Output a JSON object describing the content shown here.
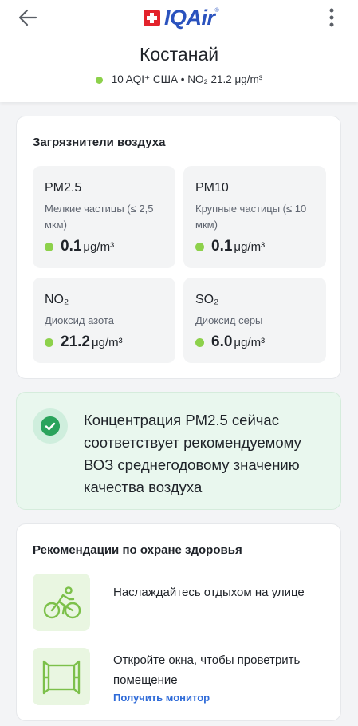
{
  "app": {
    "brand": "IQAir",
    "brand_tm": "®"
  },
  "header": {
    "city": "Костанай",
    "aqi_line": "10 AQI⁺ США • NO₂ 21.2 μg/m³"
  },
  "colors": {
    "good": "#8dd14b",
    "brand_blue": "#2a52be",
    "brand_red": "#e3232c",
    "link": "#2f6bd8",
    "who_green": "#2aa35c"
  },
  "icons": {
    "back": "arrow-left-icon",
    "menu": "more-vertical-icon",
    "check": "check-circle-icon",
    "bike": "bicycle-icon",
    "window": "open-window-icon"
  },
  "pollutants": {
    "title": "Загрязнители воздуха",
    "items": [
      {
        "name": "PM2.5",
        "desc": "Мелкие частицы (≤ 2,5 мкм)",
        "value": "0.1",
        "unit": "μg/m³"
      },
      {
        "name": "PM10",
        "desc": "Крупные частицы (≤ 10 мкм)",
        "value": "0.1",
        "unit": "μg/m³"
      },
      {
        "name": "NO₂",
        "desc": "Диоксид азота",
        "value": "21.2",
        "unit": "μg/m³"
      },
      {
        "name": "SO₂",
        "desc": "Диоксид серы",
        "value": "6.0",
        "unit": "μg/m³"
      }
    ]
  },
  "who": {
    "text": "Концентрация PM2.5 сейчас соответствует рекомендуемому ВОЗ среднегодовому значению качества воздуха"
  },
  "health": {
    "title": "Рекомендации по охране здоровья",
    "items": [
      {
        "text": "Наслаждайтесь отдыхом на улице"
      },
      {
        "text": "Откройте окна, чтобы проветрить помещение",
        "link": "Получить монитор"
      }
    ]
  }
}
